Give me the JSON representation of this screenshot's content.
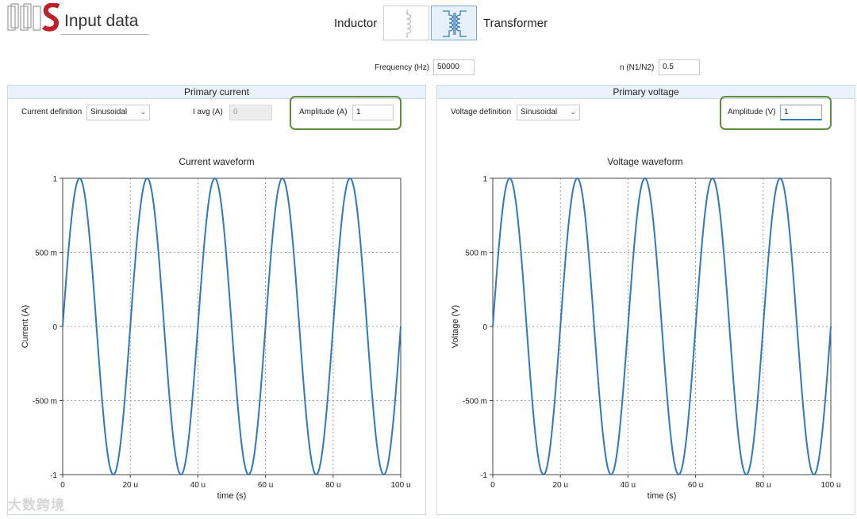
{
  "header": {
    "title": "Input data",
    "mode_inductor": "Inductor",
    "mode_transformer": "Transformer",
    "selected_mode": "Transformer"
  },
  "settings": {
    "frequency_label": "Frequency (Hz)",
    "frequency_value": "50000",
    "ratio_label": "n (N1/N2)",
    "ratio_value": "0.5"
  },
  "primary_current": {
    "heading": "Primary current",
    "definition_label": "Current definition",
    "definition_value": "Sinusoidal",
    "iavg_label": "I avg (A)",
    "iavg_value": "0",
    "amplitude_label": "Amplitude (A)",
    "amplitude_value": "1",
    "chart_title": "Current waveform"
  },
  "primary_voltage": {
    "heading": "Primary voltage",
    "definition_label": "Voltage definition",
    "definition_value": "Sinusoidal",
    "amplitude_label": "Amplitude (V)",
    "amplitude_value": "1",
    "chart_title": "Voltage waveform"
  },
  "watermark": "大数跨境",
  "colors": {
    "trace": "#2f78bd",
    "highlight": "#5f8f3d",
    "panel_header": "#e9f1fa"
  },
  "chart_data": [
    {
      "type": "line",
      "title": "Current waveform",
      "xlabel": "time (s)",
      "ylabel": "Current (A)",
      "function": "sine",
      "amplitude": 1,
      "frequency_hz": 50000,
      "xlim": [
        0,
        0.0001
      ],
      "ylim": [
        -1,
        1
      ],
      "xticks": [
        "0",
        "20 u",
        "40 u",
        "60 u",
        "80 u",
        "100 u"
      ],
      "yticks": [
        "1",
        "500 m",
        "0",
        "-500 m",
        "-1"
      ],
      "grid": true
    },
    {
      "type": "line",
      "title": "Voltage waveform",
      "xlabel": "time (s)",
      "ylabel": "Voltage (V)",
      "function": "sine",
      "amplitude": 1,
      "frequency_hz": 50000,
      "xlim": [
        0,
        0.0001
      ],
      "ylim": [
        -1,
        1
      ],
      "xticks": [
        "0",
        "20 u",
        "40 u",
        "60 u",
        "80 u",
        "100 u"
      ],
      "yticks": [
        "1",
        "500 m",
        "0",
        "-500 m",
        "-1"
      ],
      "grid": true
    }
  ]
}
